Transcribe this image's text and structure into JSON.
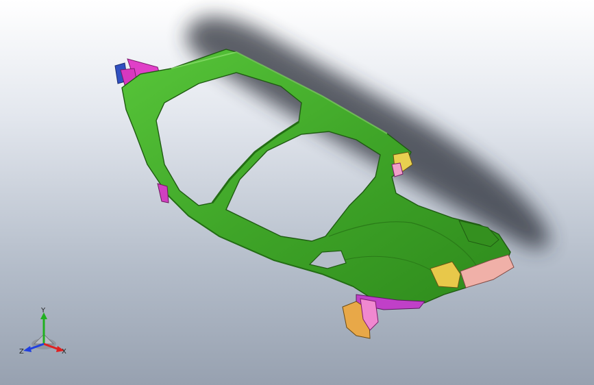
{
  "viewport": {
    "background_top": "#ffffff",
    "background_bottom": "#97a1b0"
  },
  "model": {
    "main_color": "#3fa528",
    "accent_colors": {
      "magenta": "#e040c8",
      "yellow": "#e8c84a",
      "pink": "#f0b0a8",
      "orange": "#e8a848",
      "blue": "#3050c0"
    }
  },
  "triad": {
    "x_label": "X",
    "y_label": "Y",
    "z_label": "Z",
    "x_color": "#e02020",
    "y_color": "#20b020",
    "z_color": "#2040e0"
  }
}
